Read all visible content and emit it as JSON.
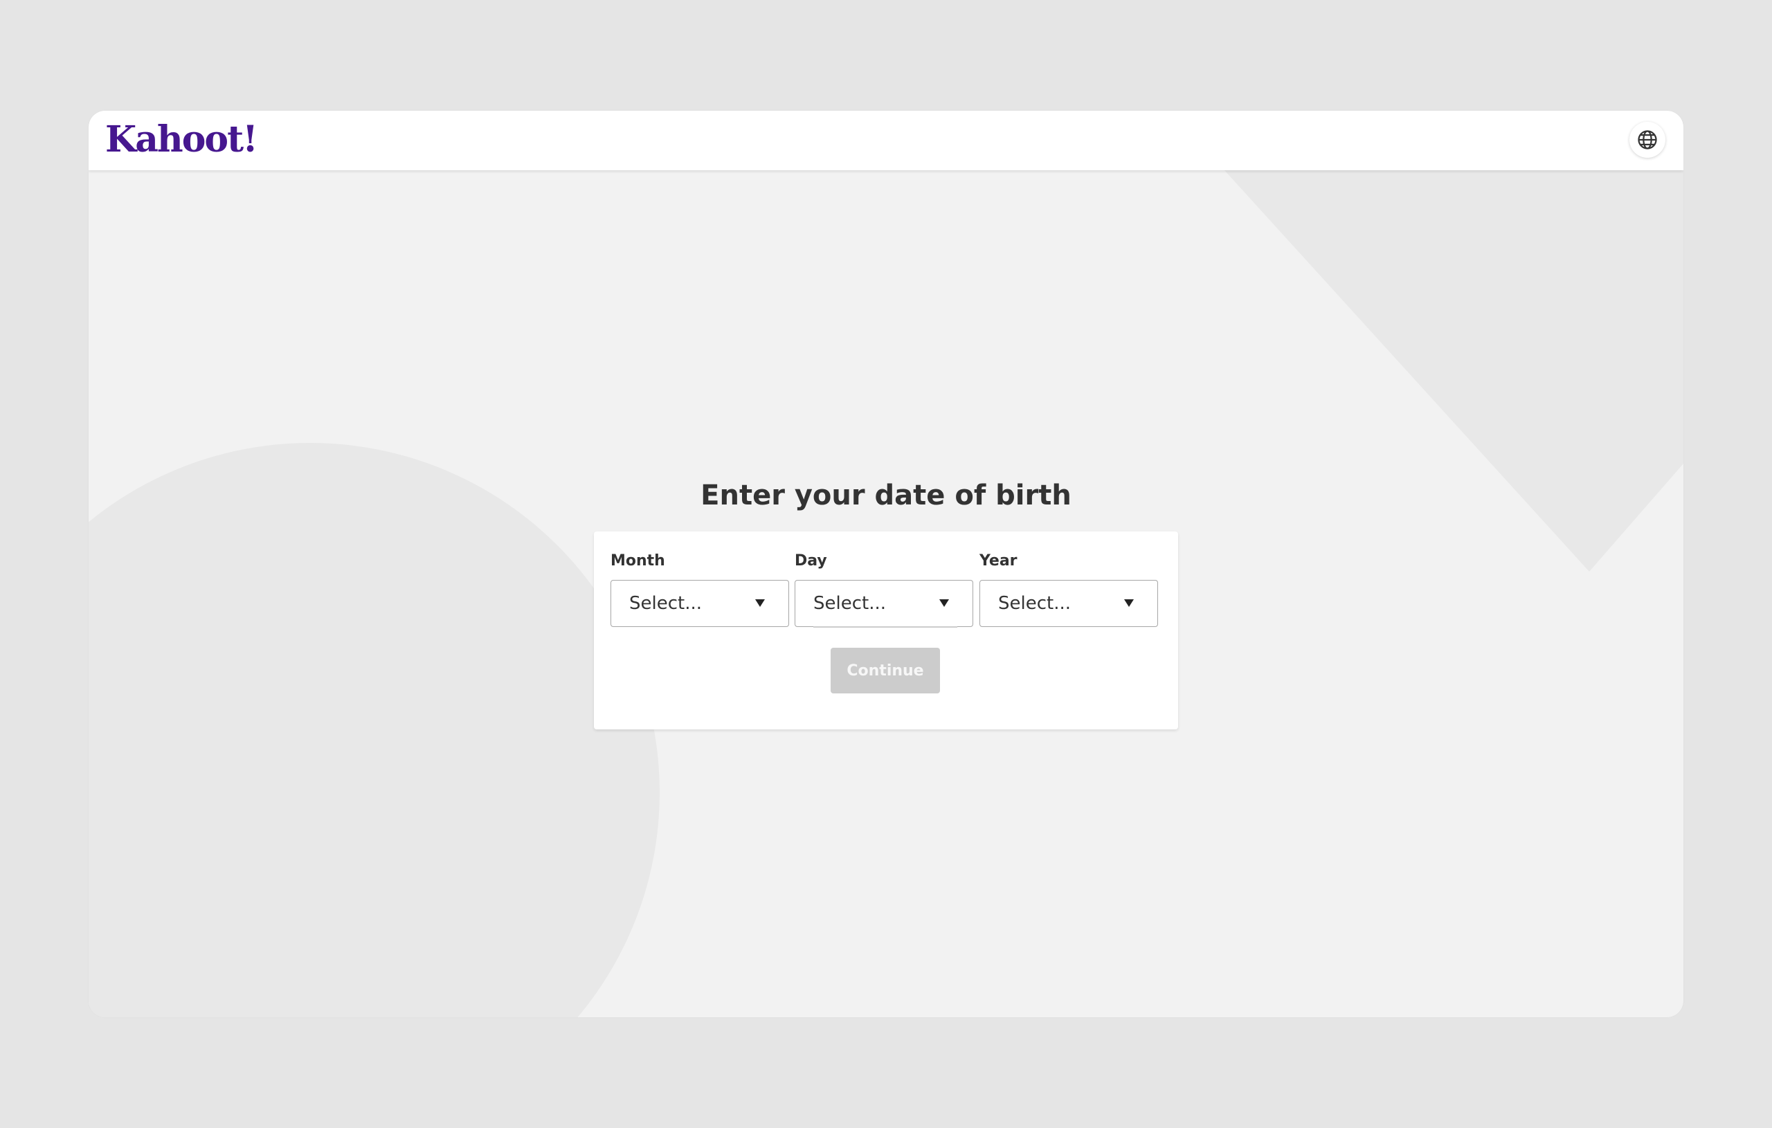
{
  "header": {
    "logo_text": "Kahoot!",
    "language_icon": "globe-icon"
  },
  "page": {
    "title": "Enter your date of birth"
  },
  "form": {
    "month": {
      "label": "Month",
      "placeholder": "Select..."
    },
    "day": {
      "label": "Day",
      "placeholder": "Select..."
    },
    "year": {
      "label": "Year",
      "placeholder": "Select..."
    },
    "continue_label": "Continue"
  },
  "colors": {
    "brand": "#46178f",
    "page_bg": "#e5e5e5",
    "window_bg": "#f2f2f2",
    "shape_bg": "#e8e8e8",
    "button_disabled": "#cccccc"
  }
}
